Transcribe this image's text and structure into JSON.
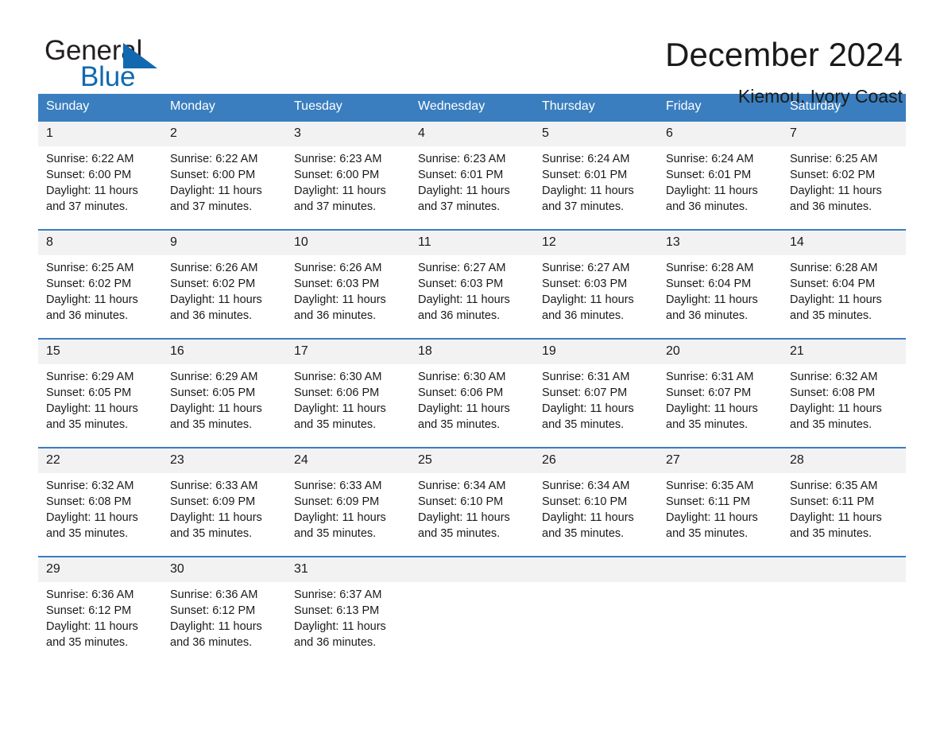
{
  "brand": {
    "word_general": "General",
    "word_blue": "Blue",
    "triangle_color": "#1269b0"
  },
  "header": {
    "month_title": "December 2024",
    "location": "Kiemou, Ivory Coast"
  },
  "theme": {
    "header_blue": "#3a7ebf",
    "daynum_bg": "#f2f2f2",
    "text": "#1a1a1a"
  },
  "calendar": {
    "weekday_headers": [
      "Sunday",
      "Monday",
      "Tuesday",
      "Wednesday",
      "Thursday",
      "Friday",
      "Saturday"
    ],
    "weeks": [
      [
        {
          "day": "1",
          "sunrise": "Sunrise: 6:22 AM",
          "sunset": "Sunset: 6:00 PM",
          "daylight_line1": "Daylight: 11 hours",
          "daylight_line2": "and 37 minutes."
        },
        {
          "day": "2",
          "sunrise": "Sunrise: 6:22 AM",
          "sunset": "Sunset: 6:00 PM",
          "daylight_line1": "Daylight: 11 hours",
          "daylight_line2": "and 37 minutes."
        },
        {
          "day": "3",
          "sunrise": "Sunrise: 6:23 AM",
          "sunset": "Sunset: 6:00 PM",
          "daylight_line1": "Daylight: 11 hours",
          "daylight_line2": "and 37 minutes."
        },
        {
          "day": "4",
          "sunrise": "Sunrise: 6:23 AM",
          "sunset": "Sunset: 6:01 PM",
          "daylight_line1": "Daylight: 11 hours",
          "daylight_line2": "and 37 minutes."
        },
        {
          "day": "5",
          "sunrise": "Sunrise: 6:24 AM",
          "sunset": "Sunset: 6:01 PM",
          "daylight_line1": "Daylight: 11 hours",
          "daylight_line2": "and 37 minutes."
        },
        {
          "day": "6",
          "sunrise": "Sunrise: 6:24 AM",
          "sunset": "Sunset: 6:01 PM",
          "daylight_line1": "Daylight: 11 hours",
          "daylight_line2": "and 36 minutes."
        },
        {
          "day": "7",
          "sunrise": "Sunrise: 6:25 AM",
          "sunset": "Sunset: 6:02 PM",
          "daylight_line1": "Daylight: 11 hours",
          "daylight_line2": "and 36 minutes."
        }
      ],
      [
        {
          "day": "8",
          "sunrise": "Sunrise: 6:25 AM",
          "sunset": "Sunset: 6:02 PM",
          "daylight_line1": "Daylight: 11 hours",
          "daylight_line2": "and 36 minutes."
        },
        {
          "day": "9",
          "sunrise": "Sunrise: 6:26 AM",
          "sunset": "Sunset: 6:02 PM",
          "daylight_line1": "Daylight: 11 hours",
          "daylight_line2": "and 36 minutes."
        },
        {
          "day": "10",
          "sunrise": "Sunrise: 6:26 AM",
          "sunset": "Sunset: 6:03 PM",
          "daylight_line1": "Daylight: 11 hours",
          "daylight_line2": "and 36 minutes."
        },
        {
          "day": "11",
          "sunrise": "Sunrise: 6:27 AM",
          "sunset": "Sunset: 6:03 PM",
          "daylight_line1": "Daylight: 11 hours",
          "daylight_line2": "and 36 minutes."
        },
        {
          "day": "12",
          "sunrise": "Sunrise: 6:27 AM",
          "sunset": "Sunset: 6:03 PM",
          "daylight_line1": "Daylight: 11 hours",
          "daylight_line2": "and 36 minutes."
        },
        {
          "day": "13",
          "sunrise": "Sunrise: 6:28 AM",
          "sunset": "Sunset: 6:04 PM",
          "daylight_line1": "Daylight: 11 hours",
          "daylight_line2": "and 36 minutes."
        },
        {
          "day": "14",
          "sunrise": "Sunrise: 6:28 AM",
          "sunset": "Sunset: 6:04 PM",
          "daylight_line1": "Daylight: 11 hours",
          "daylight_line2": "and 35 minutes."
        }
      ],
      [
        {
          "day": "15",
          "sunrise": "Sunrise: 6:29 AM",
          "sunset": "Sunset: 6:05 PM",
          "daylight_line1": "Daylight: 11 hours",
          "daylight_line2": "and 35 minutes."
        },
        {
          "day": "16",
          "sunrise": "Sunrise: 6:29 AM",
          "sunset": "Sunset: 6:05 PM",
          "daylight_line1": "Daylight: 11 hours",
          "daylight_line2": "and 35 minutes."
        },
        {
          "day": "17",
          "sunrise": "Sunrise: 6:30 AM",
          "sunset": "Sunset: 6:06 PM",
          "daylight_line1": "Daylight: 11 hours",
          "daylight_line2": "and 35 minutes."
        },
        {
          "day": "18",
          "sunrise": "Sunrise: 6:30 AM",
          "sunset": "Sunset: 6:06 PM",
          "daylight_line1": "Daylight: 11 hours",
          "daylight_line2": "and 35 minutes."
        },
        {
          "day": "19",
          "sunrise": "Sunrise: 6:31 AM",
          "sunset": "Sunset: 6:07 PM",
          "daylight_line1": "Daylight: 11 hours",
          "daylight_line2": "and 35 minutes."
        },
        {
          "day": "20",
          "sunrise": "Sunrise: 6:31 AM",
          "sunset": "Sunset: 6:07 PM",
          "daylight_line1": "Daylight: 11 hours",
          "daylight_line2": "and 35 minutes."
        },
        {
          "day": "21",
          "sunrise": "Sunrise: 6:32 AM",
          "sunset": "Sunset: 6:08 PM",
          "daylight_line1": "Daylight: 11 hours",
          "daylight_line2": "and 35 minutes."
        }
      ],
      [
        {
          "day": "22",
          "sunrise": "Sunrise: 6:32 AM",
          "sunset": "Sunset: 6:08 PM",
          "daylight_line1": "Daylight: 11 hours",
          "daylight_line2": "and 35 minutes."
        },
        {
          "day": "23",
          "sunrise": "Sunrise: 6:33 AM",
          "sunset": "Sunset: 6:09 PM",
          "daylight_line1": "Daylight: 11 hours",
          "daylight_line2": "and 35 minutes."
        },
        {
          "day": "24",
          "sunrise": "Sunrise: 6:33 AM",
          "sunset": "Sunset: 6:09 PM",
          "daylight_line1": "Daylight: 11 hours",
          "daylight_line2": "and 35 minutes."
        },
        {
          "day": "25",
          "sunrise": "Sunrise: 6:34 AM",
          "sunset": "Sunset: 6:10 PM",
          "daylight_line1": "Daylight: 11 hours",
          "daylight_line2": "and 35 minutes."
        },
        {
          "day": "26",
          "sunrise": "Sunrise: 6:34 AM",
          "sunset": "Sunset: 6:10 PM",
          "daylight_line1": "Daylight: 11 hours",
          "daylight_line2": "and 35 minutes."
        },
        {
          "day": "27",
          "sunrise": "Sunrise: 6:35 AM",
          "sunset": "Sunset: 6:11 PM",
          "daylight_line1": "Daylight: 11 hours",
          "daylight_line2": "and 35 minutes."
        },
        {
          "day": "28",
          "sunrise": "Sunrise: 6:35 AM",
          "sunset": "Sunset: 6:11 PM",
          "daylight_line1": "Daylight: 11 hours",
          "daylight_line2": "and 35 minutes."
        }
      ],
      [
        {
          "day": "29",
          "sunrise": "Sunrise: 6:36 AM",
          "sunset": "Sunset: 6:12 PM",
          "daylight_line1": "Daylight: 11 hours",
          "daylight_line2": "and 35 minutes."
        },
        {
          "day": "30",
          "sunrise": "Sunrise: 6:36 AM",
          "sunset": "Sunset: 6:12 PM",
          "daylight_line1": "Daylight: 11 hours",
          "daylight_line2": "and 36 minutes."
        },
        {
          "day": "31",
          "sunrise": "Sunrise: 6:37 AM",
          "sunset": "Sunset: 6:13 PM",
          "daylight_line1": "Daylight: 11 hours",
          "daylight_line2": "and 36 minutes."
        },
        {
          "day": "",
          "sunrise": "",
          "sunset": "",
          "daylight_line1": "",
          "daylight_line2": ""
        },
        {
          "day": "",
          "sunrise": "",
          "sunset": "",
          "daylight_line1": "",
          "daylight_line2": ""
        },
        {
          "day": "",
          "sunrise": "",
          "sunset": "",
          "daylight_line1": "",
          "daylight_line2": ""
        },
        {
          "day": "",
          "sunrise": "",
          "sunset": "",
          "daylight_line1": "",
          "daylight_line2": ""
        }
      ]
    ]
  }
}
